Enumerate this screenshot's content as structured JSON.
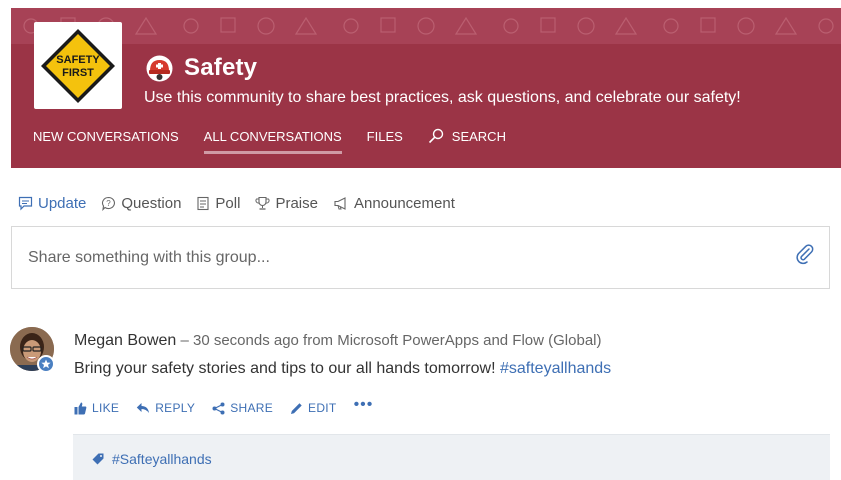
{
  "group": {
    "title": "Safety",
    "subtitle": "Use this community to share best practices, ask questions, and celebrate our safety!",
    "logo_text_line1": "SAFETY",
    "logo_text_line2": "FIRST"
  },
  "nav": {
    "items": [
      {
        "label": "NEW CONVERSATIONS"
      },
      {
        "label": "ALL CONVERSATIONS",
        "active": true
      },
      {
        "label": "FILES"
      },
      {
        "label": "SEARCH"
      }
    ]
  },
  "publisher": {
    "tabs": [
      {
        "label": "Update",
        "icon": "chat-bubble-icon",
        "active": true
      },
      {
        "label": "Question",
        "icon": "question-bubble-icon"
      },
      {
        "label": "Poll",
        "icon": "poll-icon"
      },
      {
        "label": "Praise",
        "icon": "trophy-icon"
      },
      {
        "label": "Announcement",
        "icon": "megaphone-icon"
      }
    ],
    "placeholder": "Share something with this group..."
  },
  "post": {
    "author": "Megan Bowen",
    "meta": " – 30 seconds ago from Microsoft PowerApps and Flow (Global)",
    "body": "Bring your safety stories and tips to our all hands tomorrow! ",
    "hashtag": "#safteyallhands",
    "actions": {
      "like": "LIKE",
      "reply": "REPLY",
      "share": "SHARE",
      "edit": "EDIT",
      "more": "•••"
    },
    "topic": "#Safteyallhands"
  },
  "colors": {
    "banner": "#9b3446",
    "accent_blue": "#3e6fb4",
    "sign_yellow": "#f4c20d"
  }
}
